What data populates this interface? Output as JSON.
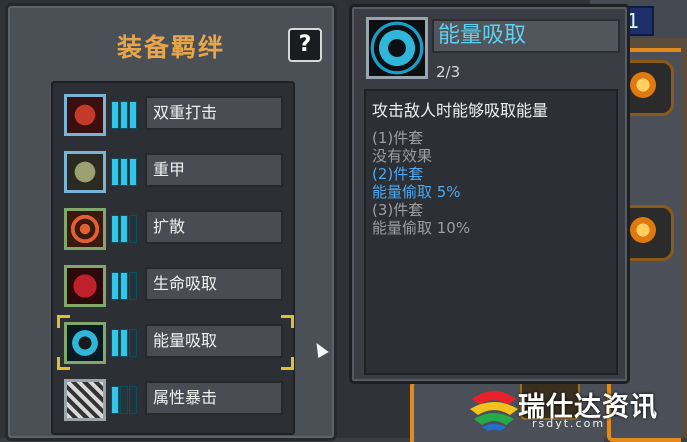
{
  "panel": {
    "title": "装备羁绊",
    "help_label": "?"
  },
  "set_list": [
    {
      "name": "双重打击",
      "icon": "double-strike-icon",
      "filled_bars": 3,
      "total_bars": 3,
      "selected": false
    },
    {
      "name": "重甲",
      "icon": "heavy-armor-icon",
      "filled_bars": 3,
      "total_bars": 3,
      "selected": false
    },
    {
      "name": "扩散",
      "icon": "spread-icon",
      "filled_bars": 2,
      "total_bars": 3,
      "selected": false
    },
    {
      "name": "生命吸取",
      "icon": "life-steal-icon",
      "filled_bars": 2,
      "total_bars": 3,
      "selected": false
    },
    {
      "name": "能量吸取",
      "icon": "energy-steal-icon",
      "filled_bars": 2,
      "total_bars": 3,
      "selected": true
    },
    {
      "name": "属性暴击",
      "icon": "elemental-crit-icon",
      "filled_bars": 1,
      "total_bars": 3,
      "selected": false
    }
  ],
  "tooltip": {
    "name": "能量吸取",
    "count": "2/3",
    "description": "攻击敌人时能够吸取能量",
    "tiers": [
      {
        "header": "(1)件套",
        "effect": "没有效果",
        "active": false
      },
      {
        "header": "(2)件套",
        "effect": "能量偷取 5%",
        "active": true
      },
      {
        "header": "(3)件套",
        "effect": "能量偷取 10%",
        "active": false
      }
    ]
  },
  "background": {
    "top_right_number": "1"
  },
  "watermark": {
    "text": "瑞仕达资讯",
    "url": "rsdyt.com"
  },
  "colors": {
    "title": "#e8a64a",
    "active_tier": "#4fa7ee",
    "inactive_tier": "#9a9ea3",
    "bar_on": "#34c6e8",
    "selected_corner": "#e1c02a"
  }
}
